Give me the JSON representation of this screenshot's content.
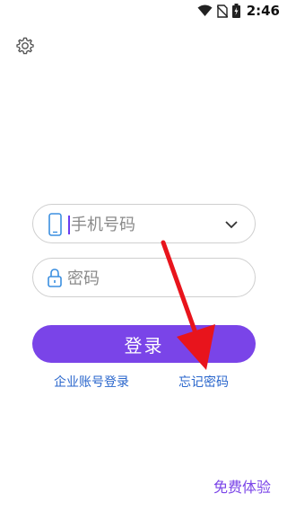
{
  "status_bar": {
    "time": "2:46",
    "icons": [
      "wifi-icon",
      "no-sim-icon",
      "battery-charging-icon"
    ]
  },
  "settings": {
    "icon": "gear-icon"
  },
  "logo": {
    "icon": "waveform-logo"
  },
  "phone_field": {
    "placeholder": "手机号码",
    "icon": "phone-icon",
    "dropdown_icon": "chevron-down-icon"
  },
  "password_field": {
    "placeholder": "密码",
    "icon": "lock-icon"
  },
  "login_button": {
    "label": "登录"
  },
  "links": {
    "enterprise_login": "企业账号登录",
    "forgot_password": "忘记密码"
  },
  "free_trial": "免费体验",
  "colors": {
    "accent": "#7a44e8",
    "link": "#2a66cc",
    "annotation_arrow": "#e8141c"
  }
}
